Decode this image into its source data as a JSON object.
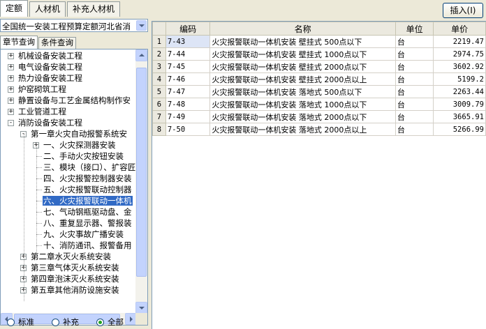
{
  "top_tabs": [
    "定额",
    "人材机",
    "补充人材机"
  ],
  "insert_button": "插入(I)",
  "combo": {
    "value": "全国统一安装工程预算定额河北省消"
  },
  "sub_tabs": [
    "章节查询",
    "条件查询"
  ],
  "tree": [
    {
      "label": "机械设备安装工程",
      "toggle": "+"
    },
    {
      "label": "电气设备安装工程",
      "toggle": "+"
    },
    {
      "label": "热力设备安装工程",
      "toggle": "+"
    },
    {
      "label": "炉窑砌筑工程",
      "toggle": "+"
    },
    {
      "label": "静置设备与工艺金属结构制作安",
      "toggle": "+"
    },
    {
      "label": "工业管道工程",
      "toggle": "+"
    },
    {
      "label": "消防设备安装工程",
      "toggle": "-"
    },
    {
      "label": "第一章火灾自动报警系统安",
      "toggle": "-"
    },
    {
      "label": "一、火灾探测器安装",
      "toggle": "+"
    },
    {
      "label": "二、手动火灾按钮安装"
    },
    {
      "label": "三、模块（接口）、扩容匠"
    },
    {
      "label": "四、火灾报警控制器安装"
    },
    {
      "label": "五、火灾报警联动控制器"
    },
    {
      "label": "六、火灾报警联动一体机",
      "selected": true
    },
    {
      "label": "七、气动钢瓶驱动盘、金"
    },
    {
      "label": "八、重复显示器、警报装"
    },
    {
      "label": "九、火灾事故广播安装"
    },
    {
      "label": "十、消防通讯、报警备用"
    },
    {
      "label": "第二章水灭火系统安装",
      "toggle": "+"
    },
    {
      "label": "第三章气体灭火系统安装",
      "toggle": "+"
    },
    {
      "label": "第四章泡沫灭火系统安装",
      "toggle": "+"
    },
    {
      "label": "第五章其他消防设施安装",
      "toggle": "+"
    }
  ],
  "radios": [
    {
      "label": "标准",
      "checked": false
    },
    {
      "label": "补充",
      "checked": false
    },
    {
      "label": "全部",
      "checked": true
    }
  ],
  "grid": {
    "headers": [
      "编码",
      "名称",
      "单位",
      "单价"
    ],
    "rows": [
      {
        "n": "1",
        "code": "7-43",
        "name": "火灾报警联动一体机安装 壁挂式 500点以下",
        "unit": "台",
        "price": "2219.47"
      },
      {
        "n": "2",
        "code": "7-44",
        "name": "火灾报警联动一体机安装 壁挂式 1000点以下",
        "unit": "台",
        "price": "2974.75"
      },
      {
        "n": "3",
        "code": "7-45",
        "name": "火灾报警联动一体机安装 壁挂式 2000点以下",
        "unit": "台",
        "price": "3602.92"
      },
      {
        "n": "4",
        "code": "7-46",
        "name": "火灾报警联动一体机安装 壁挂式 2000点以上",
        "unit": "台",
        "price": "5199.2"
      },
      {
        "n": "5",
        "code": "7-47",
        "name": "火灾报警联动一体机安装 落地式 500点以下",
        "unit": "台",
        "price": "2263.44"
      },
      {
        "n": "6",
        "code": "7-48",
        "name": "火灾报警联动一体机安装 落地式 1000点以下",
        "unit": "台",
        "price": "3009.79"
      },
      {
        "n": "7",
        "code": "7-49",
        "name": "火灾报警联动一体机安装 落地式 2000点以下",
        "unit": "台",
        "price": "3665.91"
      },
      {
        "n": "8",
        "code": "7-50",
        "name": "火灾报警联动一体机安装 落地式 2000点以上",
        "unit": "台",
        "price": "5266.99"
      }
    ]
  },
  "colors": {
    "selection": "#316ac5",
    "header_bg": "#ebe9df",
    "window_bg": "#ece9d8"
  }
}
